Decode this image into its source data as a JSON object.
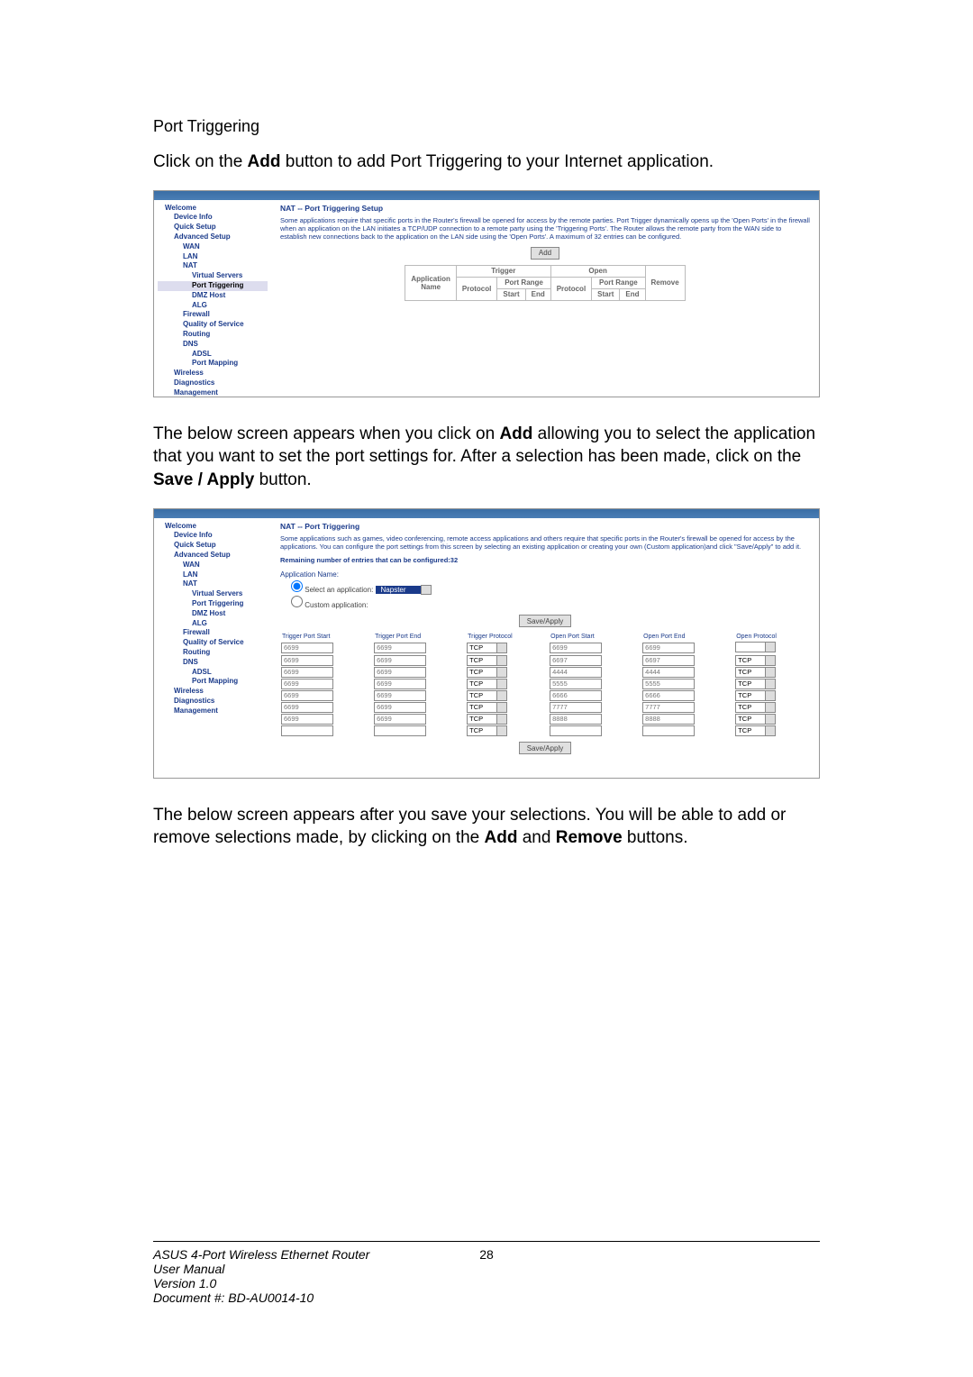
{
  "doc": {
    "heading": "Port Triggering",
    "p1_pre": "Click on the ",
    "p1_bold": "Add",
    "p1_post": " button to add Port Triggering to your Internet application.",
    "p2_pre": "The below screen appears when you click on ",
    "p2_bold1": "Add",
    "p2_mid": " allowing you to select the application that you want to set the port settings for.  After a selection has been made, click on the ",
    "p2_bold2": "Save / Apply",
    "p2_post": " button.",
    "p3_pre": "The below screen appears after you save your selections.  You will be able to add or remove selections made, by clicking on the ",
    "p3_bold1": "Add",
    "p3_mid": " and ",
    "p3_bold2": "Remove",
    "p3_post": " buttons."
  },
  "sidebar": {
    "welcome": "Welcome",
    "device_info": "Device Info",
    "quick_setup": "Quick Setup",
    "advanced_setup": "Advanced Setup",
    "wan": "WAN",
    "lan": "LAN",
    "nat": "NAT",
    "virtual_servers": "Virtual Servers",
    "port_triggering": "Port Triggering",
    "dmz_host": "DMZ Host",
    "alg": "ALG",
    "firewall": "Firewall",
    "qos": "Quality of Service",
    "routing": "Routing",
    "dns": "DNS",
    "adsl": "ADSL",
    "port_mapping": "Port Mapping",
    "wireless": "Wireless",
    "diagnostics": "Diagnostics",
    "management": "Management"
  },
  "scr1": {
    "title": "NAT -- Port Triggering Setup",
    "desc": "Some applications require that specific ports in the Router's firewall be opened for access by the remote parties. Port Trigger dynamically opens up the 'Open Ports' in the firewall when an application on the LAN initiates a TCP/UDP connection to a remote party using the 'Triggering Ports'. The Router allows the remote party from the WAN side to establish new connections back to the application on the LAN side using the 'Open Ports'. A maximum of 32 entries can be configured.",
    "add": "Add",
    "th_application": "Application",
    "th_trigger": "Trigger",
    "th_open": "Open",
    "th_remove": "Remove",
    "th_name": "Name",
    "th_protocol": "Protocol",
    "th_port_range": "Port Range",
    "th_start": "Start",
    "th_end": "End"
  },
  "scr2": {
    "title": "NAT -- Port Triggering",
    "desc": "Some applications such as games, video conferencing, remote access applications and others require that specific ports in the Router's firewall be opened for access by the applications. You can configure the port settings from this screen by selecting an existing application or creating your own (Custom application)and click \"Save/Apply\" to add it.",
    "remaining": "Remaining number of entries that can be configured:32",
    "app_name": "Application Name:",
    "select_app": "Select an application:",
    "select_value": "Napster",
    "custom_app": "Custom application:",
    "save_apply": "Save/Apply",
    "headers": [
      "Trigger Port Start",
      "Trigger Port End",
      "Trigger Protocol",
      "Open Port Start",
      "Open Port End",
      "Open Protocol"
    ],
    "rows": [
      {
        "tps": "6699",
        "tpe": "6699",
        "tpr": "TCP",
        "ops": "6699",
        "ope": "6699",
        "opr": ""
      },
      {
        "tps": "6699",
        "tpe": "6699",
        "tpr": "TCP",
        "ops": "6697",
        "ope": "6697",
        "opr": "TCP"
      },
      {
        "tps": "6699",
        "tpe": "6699",
        "tpr": "TCP",
        "ops": "4444",
        "ope": "4444",
        "opr": "TCP"
      },
      {
        "tps": "6699",
        "tpe": "6699",
        "tpr": "TCP",
        "ops": "5555",
        "ope": "5555",
        "opr": "TCP"
      },
      {
        "tps": "6699",
        "tpe": "6699",
        "tpr": "TCP",
        "ops": "6666",
        "ope": "6666",
        "opr": "TCP"
      },
      {
        "tps": "6699",
        "tpe": "6699",
        "tpr": "TCP",
        "ops": "7777",
        "ope": "7777",
        "opr": "TCP"
      },
      {
        "tps": "6699",
        "tpe": "6699",
        "tpr": "TCP",
        "ops": "8888",
        "ope": "8888",
        "opr": "TCP"
      },
      {
        "tps": "",
        "tpe": "",
        "tpr": "TCP",
        "ops": "",
        "ope": "",
        "opr": "TCP"
      }
    ]
  },
  "footer": {
    "l1": "ASUS 4-Port Wireless Ethernet Router",
    "l2": "User Manual",
    "l3": "Version 1.0",
    "l4": "Document #:  BD-AU0014-10",
    "page": "28"
  }
}
